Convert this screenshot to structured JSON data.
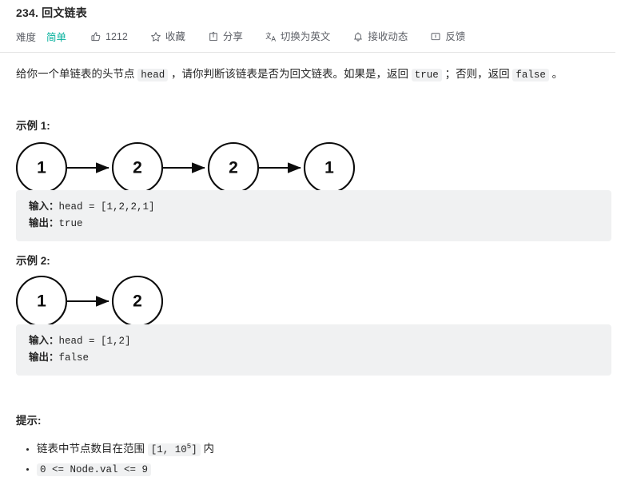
{
  "header": {
    "title": "234. 回文链表",
    "difficulty_label": "难度",
    "difficulty_value": "简单",
    "difficulty_color": "#00af9b",
    "likes": "1212",
    "favorite_label": "收藏",
    "share_label": "分享",
    "translate_label": "切换为英文",
    "subscribe_label": "接收动态",
    "feedback_label": "反馈",
    "icons": {
      "like": "thumbs-up-icon",
      "favorite": "star-icon",
      "share": "share-icon",
      "translate": "translate-icon",
      "subscribe": "bell-icon",
      "feedback": "comment-icon"
    }
  },
  "description": {
    "part1": "给你一个单链表的头节点 ",
    "code1": "head",
    "part2": " ，请你判断该链表是否为回文链表。如果是，返回 ",
    "code2": "true",
    "part3": " ；否则，返回 ",
    "code3": "false",
    "part4": " 。"
  },
  "examples": [
    {
      "label": "示例 1:",
      "diagram": {
        "nodes": [
          "1",
          "2",
          "2",
          "1"
        ]
      },
      "input_label": "输入：",
      "input_value": "head = [1,2,2,1]",
      "output_label": "输出：",
      "output_value": "true"
    },
    {
      "label": "示例 2:",
      "diagram": {
        "nodes": [
          "1",
          "2"
        ]
      },
      "input_label": "输入：",
      "input_value": "head = [1,2]",
      "output_label": "输出：",
      "output_value": "false"
    }
  ],
  "hints": {
    "title": "提示:",
    "items": [
      {
        "prefix": "链表中节点数目在范围 ",
        "code": "[1, 10",
        "sup": "5",
        "code_tail": "]",
        "suffix": " 内"
      },
      {
        "prefix": "",
        "code": "0 <= Node.val <= 9",
        "sup": "",
        "code_tail": "",
        "suffix": ""
      }
    ]
  }
}
